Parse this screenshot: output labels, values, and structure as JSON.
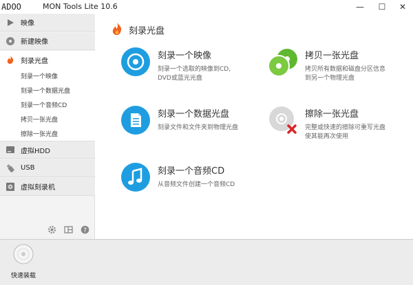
{
  "window": {
    "title": "MON Tools Lite 10.6",
    "watermark": "ADOO",
    "min": "—",
    "max": "☐",
    "close": "✕"
  },
  "sidebar": {
    "items": [
      {
        "label": "映像",
        "icon": "play-icon"
      },
      {
        "label": "新建映像",
        "icon": "disc-gear-icon"
      },
      {
        "label": "刻录光盘",
        "icon": "flame-icon"
      },
      {
        "label": "虚拟HDD",
        "icon": "hdd-icon"
      },
      {
        "label": "USB",
        "icon": "usb-icon"
      },
      {
        "label": "虚拟刻录机",
        "icon": "burner-icon"
      }
    ],
    "subitems": [
      "刻录一个映像",
      "刻录一个数据光盘",
      "刻录一个音频CD",
      "拷贝一张光盘",
      "擦除一张光盘"
    ],
    "tools": [
      "gear-icon",
      "layout-icon",
      "help-icon"
    ]
  },
  "main": {
    "header": "刻录光盘",
    "actions": [
      {
        "title": "刻录一个映像",
        "desc1": "刻录一个选取的映像到CD,",
        "desc2": "DVD或蓝光光盘",
        "icon": "disc-burn-icon"
      },
      {
        "title": "拷贝一张光盘",
        "desc1": "拷贝所有数据和磁盘分区信息",
        "desc2": "到另一个物理光盘",
        "icon": "copy-disc-icon"
      },
      {
        "title": "刻录一个数据光盘",
        "desc1": "刻录文件和文件夹到物理光盘",
        "desc2": "",
        "icon": "data-disc-icon"
      },
      {
        "title": "擦除一张光盘",
        "desc1": "完整或快速的擦除可重写光盘",
        "desc2": "使其能再次使用",
        "icon": "erase-disc-icon"
      },
      {
        "title": "刻录一个音频CD",
        "desc1": "从音频文件创建一个音频CD",
        "desc2": "",
        "icon": "music-note-icon"
      }
    ]
  },
  "bottombar": {
    "quick_mount": "快速装载"
  },
  "colors": {
    "accent_blue": "#1e9ee0",
    "accent_green": "#5fb830",
    "flame_orange": "#f2621f",
    "erase_red": "#d9262a"
  }
}
